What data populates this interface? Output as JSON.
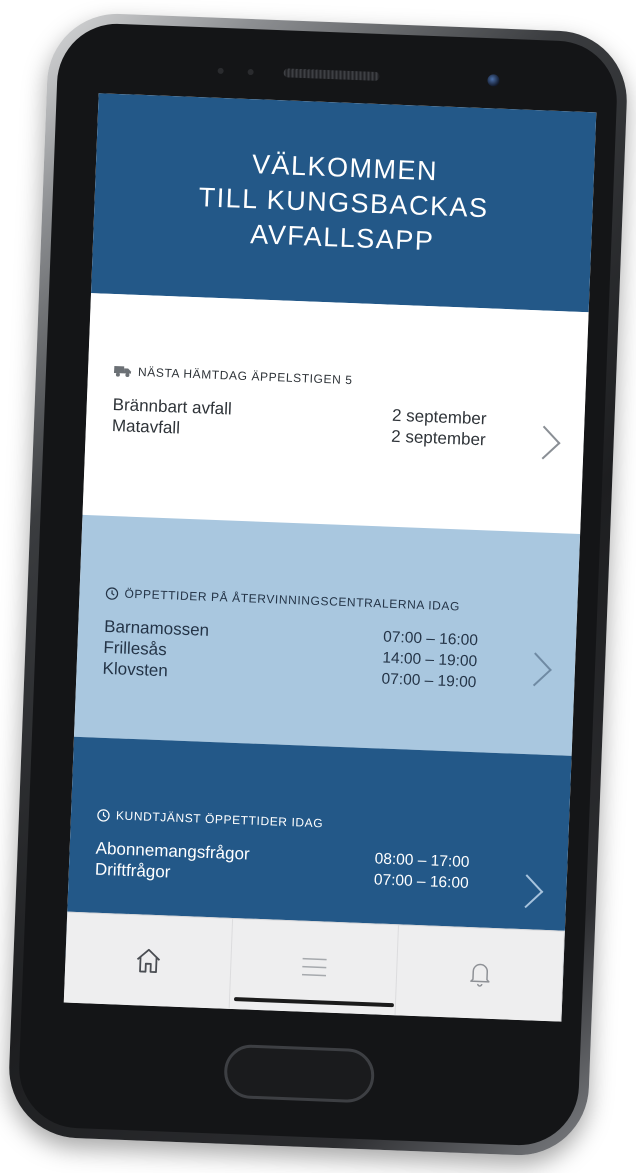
{
  "header": {
    "line1": "VÄLKOMMEN",
    "line2": "TILL KUNGSBACKAS",
    "line3": "AVFALLSAPP"
  },
  "pickup": {
    "heading": "NÄSTA HÄMTDAG ÄPPELSTIGEN 5",
    "icon": "truck-icon",
    "items": [
      {
        "label": "Brännbart avfall",
        "value": "2 september"
      },
      {
        "label": "Matavfall",
        "value": "2 september"
      }
    ]
  },
  "recycling": {
    "heading": "ÖPPETTIDER PÅ ÅTERVINNINGSCENTRALERNA IDAG",
    "icon": "clock-icon",
    "items": [
      {
        "label": "Barnamossen",
        "value": "07:00 – 16:00"
      },
      {
        "label": "Frillesås",
        "value": "14:00 – 19:00"
      },
      {
        "label": "Klovsten",
        "value": "07:00 – 19:00"
      }
    ]
  },
  "customer_service": {
    "heading": "KUNDTJÄNST ÖPPETTIDER IDAG",
    "icon": "clock-icon",
    "items": [
      {
        "label": "Abonnemangsfrågor",
        "value": "08:00 – 17:00"
      },
      {
        "label": "Driftfrågor",
        "value": "07:00 – 16:00"
      }
    ]
  },
  "tabbar": {
    "tabs": [
      {
        "icon": "home-icon"
      },
      {
        "icon": "menu-icon"
      },
      {
        "icon": "bell-icon"
      }
    ]
  },
  "colors": {
    "primary": "#235888",
    "light_blue": "#a9c7df",
    "tabbar_bg": "#eeeeef"
  }
}
